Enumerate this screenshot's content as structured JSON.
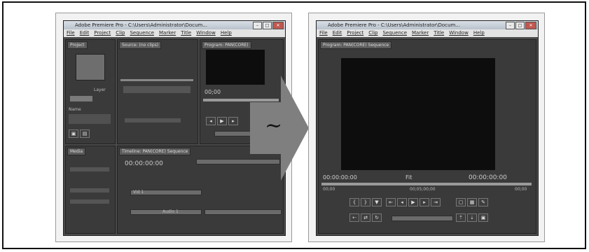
{
  "left_window": {
    "title": "Adobe Premiere Pro - C:\\Users\\Administrator\\Docum...",
    "menu": [
      "File",
      "Edit",
      "Project",
      "Clip",
      "Sequence",
      "Marker",
      "Title",
      "Window",
      "Help"
    ],
    "tabs": {
      "project": "Project",
      "source": "Source: (no clips)",
      "program": "Program: PAN(CORE)",
      "media": "Media",
      "timeline": "Timeline: PAN(CORE) Sequence"
    },
    "timecodes": {
      "timeline": "00:00:00:00",
      "program": "00;00",
      "program_right": "00;00"
    },
    "labels": {
      "layer": "Layer",
      "name": "Name",
      "video": "Vid 1",
      "audio": "Audio 1"
    }
  },
  "right_window": {
    "title": "Adobe Premiere Pro - C:\\Users\\Administrator\\Docum...",
    "menu": [
      "File",
      "Edit",
      "Project",
      "Clip",
      "Sequence",
      "Marker",
      "Title",
      "Window",
      "Help"
    ],
    "tab": "Program: PAN(CORE) Sequence",
    "timecode_left": "00:00:00:00",
    "fit": "Fit",
    "timecode_right": "00:00:00:00",
    "ruler_left": "00;00",
    "ruler_mid": "00;05;00;00",
    "ruler_right": "00;00"
  },
  "arrow_symbol": "~"
}
